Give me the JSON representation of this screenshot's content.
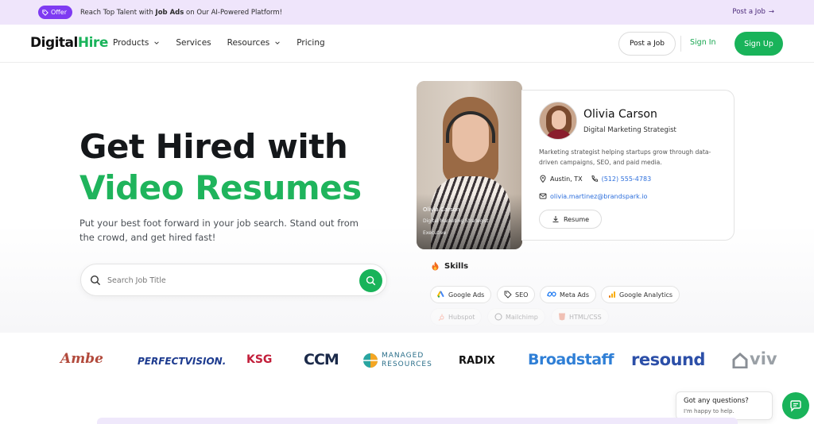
{
  "promo": {
    "badge": "Offer",
    "text_pre": "Reach Top Talent with ",
    "text_bold": "Job Ads",
    "text_post": " on Our AI-Powered Platform!",
    "link": "Post a Job",
    "link_arrow": "→"
  },
  "nav": {
    "logo_a": "Digital",
    "logo_b": "Hire",
    "menu": [
      "Products",
      "Services",
      "Resources",
      "Pricing"
    ],
    "post_job": "Post a Job",
    "sign_in": "Sign In",
    "sign_up": "Sign Up"
  },
  "hero": {
    "title_line1": "Get Hired with",
    "title_line2": "Video Resumes",
    "subtitle": "Put your best foot forward in your job search. Stand out from the crowd, and get hired fast!",
    "search_placeholder": "Search Job Title"
  },
  "profile": {
    "video_name": "Olivia Carson",
    "video_role": "Digital Marketing Strategist",
    "video_level": "Executive",
    "name": "Olivia Carson",
    "role": "Digital Marketing Strategist",
    "description": "Marketing strategist helping startups grow through data-driven campaigns, SEO, and paid media.",
    "location": "Austin, TX",
    "phone": "(512) 555-4783",
    "email": "olivia.martinez@brandspark.io",
    "resume_button": "Resume"
  },
  "skills": {
    "title": "Skills",
    "items": [
      "Google Ads",
      "SEO",
      "Meta Ads",
      "Google Analytics"
    ],
    "faded_items": [
      "Hubspot",
      "Mailchimp",
      "HTML/CSS"
    ]
  },
  "logos": [
    "Ambe",
    "PERFECTVISION.",
    "KSG",
    "CCM",
    "MANAGED",
    "RESOURCES",
    "RADIX",
    "Broadstaff",
    "resound",
    "viv"
  ],
  "chat": {
    "title": "Got any questions?",
    "subtitle": "I'm happy to help."
  },
  "colors": {
    "brand_green": "#19b35a",
    "promo_bg": "#efe5fb",
    "offer_purple": "#7e3af2",
    "link_blue": "#2d6fdc"
  }
}
